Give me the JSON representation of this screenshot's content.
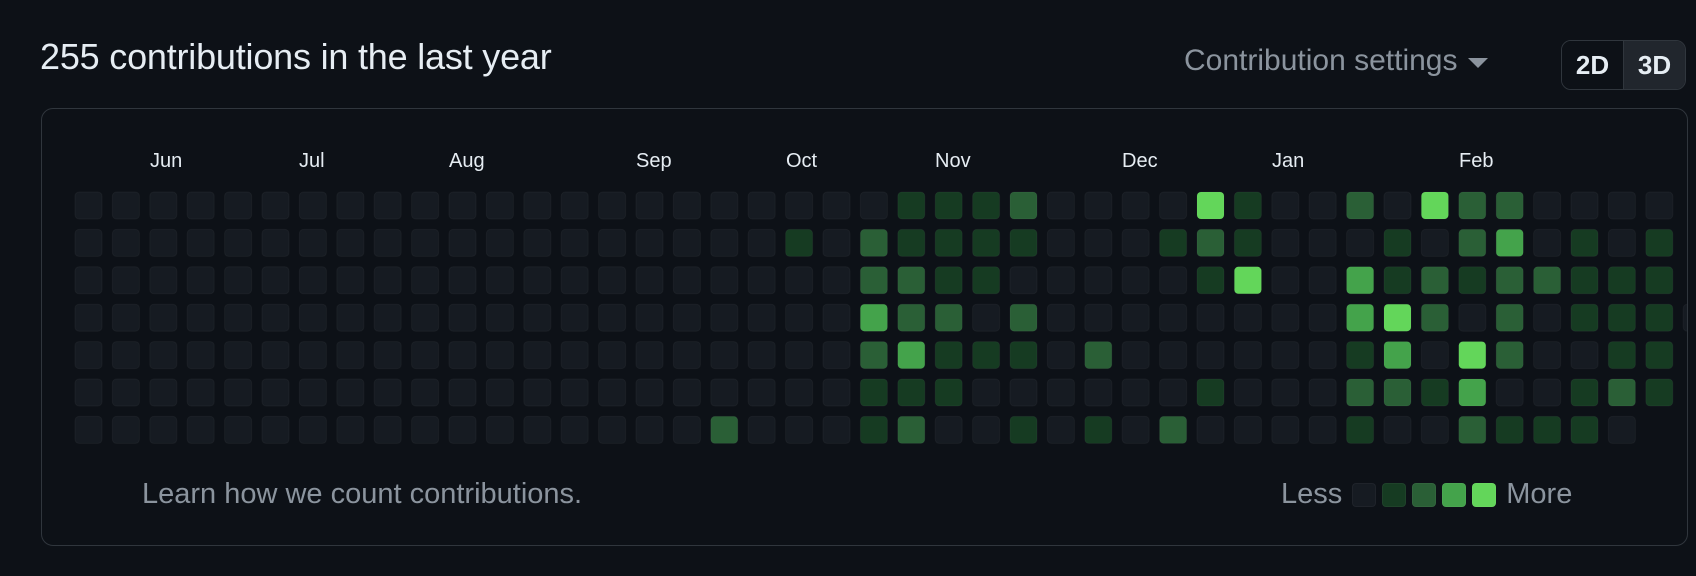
{
  "heading": "255 contributions in the last year",
  "settings": {
    "label": "Contribution settings",
    "caret_icon": "caret-down-icon"
  },
  "view_toggle": {
    "options": [
      "2D",
      "3D"
    ],
    "selected": "2D"
  },
  "months": [
    "Jun",
    "Jul",
    "Aug",
    "Sep",
    "Oct",
    "Nov",
    "Dec",
    "Jan",
    "Feb"
  ],
  "month_week_index": [
    2,
    6,
    10,
    15,
    19,
    23,
    28,
    32,
    37
  ],
  "footer": {
    "learn_link": "Learn how we count contributions."
  },
  "legend": {
    "less": "Less",
    "more": "More"
  },
  "colors": {
    "background": "#0d1117",
    "levels": [
      "#161b22",
      "#0e4429",
      "#006d32",
      "#26a641",
      "#39d353"
    ],
    "levels_rendered": [
      "#161b22",
      "#163b22",
      "#2a5f36",
      "#44a34b",
      "#63d65a"
    ]
  },
  "contribution_levels": [
    [
      0,
      0,
      0,
      0,
      0,
      0,
      0,
      0,
      0,
      0,
      0,
      0,
      0,
      0,
      0,
      0,
      0,
      0,
      0,
      0,
      0,
      0,
      1,
      1,
      1,
      2,
      0,
      0,
      0,
      0,
      4,
      1,
      0,
      0,
      2,
      0,
      4,
      2,
      2,
      0,
      0,
      0,
      0
    ],
    [
      0,
      0,
      0,
      0,
      0,
      0,
      0,
      0,
      0,
      0,
      0,
      0,
      0,
      0,
      0,
      0,
      0,
      0,
      0,
      1,
      0,
      2,
      1,
      1,
      1,
      1,
      0,
      0,
      0,
      1,
      2,
      1,
      0,
      0,
      0,
      1,
      0,
      2,
      3,
      0,
      1,
      0,
      1
    ],
    [
      0,
      0,
      0,
      0,
      0,
      0,
      0,
      0,
      0,
      0,
      0,
      0,
      0,
      0,
      0,
      0,
      0,
      0,
      0,
      0,
      0,
      2,
      2,
      1,
      1,
      0,
      0,
      0,
      0,
      0,
      1,
      4,
      0,
      0,
      3,
      1,
      2,
      1,
      2,
      2,
      1,
      1,
      1
    ],
    [
      0,
      0,
      0,
      0,
      0,
      0,
      0,
      0,
      0,
      0,
      0,
      0,
      0,
      0,
      0,
      0,
      0,
      0,
      0,
      0,
      0,
      3,
      2,
      2,
      0,
      2,
      0,
      0,
      0,
      0,
      0,
      0,
      0,
      0,
      3,
      4,
      2,
      0,
      2,
      0,
      1,
      1,
      1,
      0
    ],
    [
      0,
      0,
      0,
      0,
      0,
      0,
      0,
      0,
      0,
      0,
      0,
      0,
      0,
      0,
      0,
      0,
      0,
      0,
      0,
      0,
      0,
      2,
      3,
      1,
      1,
      1,
      0,
      2,
      0,
      0,
      0,
      0,
      0,
      0,
      1,
      3,
      0,
      4,
      2,
      0,
      0,
      1,
      1
    ],
    [
      0,
      0,
      0,
      0,
      0,
      0,
      0,
      0,
      0,
      0,
      0,
      0,
      0,
      0,
      0,
      0,
      0,
      0,
      0,
      0,
      0,
      1,
      1,
      1,
      0,
      0,
      0,
      0,
      0,
      0,
      1,
      0,
      0,
      0,
      2,
      2,
      1,
      3,
      0,
      0,
      1,
      2,
      1
    ],
    [
      0,
      0,
      0,
      0,
      0,
      0,
      0,
      0,
      0,
      0,
      0,
      0,
      0,
      0,
      0,
      0,
      0,
      2,
      0,
      0,
      0,
      1,
      2,
      0,
      0,
      1,
      0,
      1,
      0,
      2,
      0,
      0,
      0,
      0,
      1,
      0,
      0,
      2,
      1,
      1,
      1,
      0
    ]
  ]
}
